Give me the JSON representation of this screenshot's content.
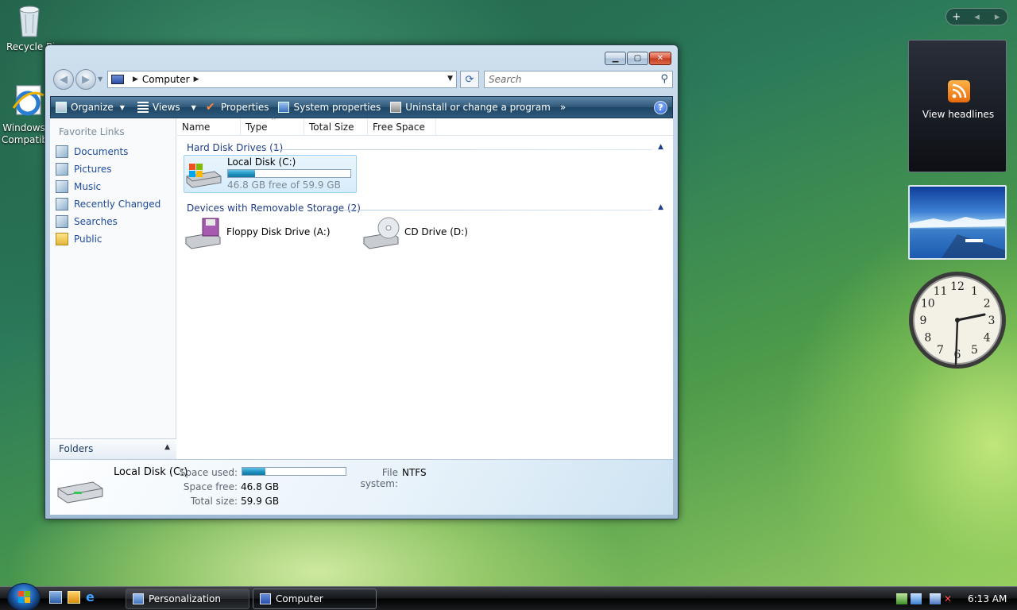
{
  "desktop": {
    "icons": [
      {
        "label": "Recycle Bin",
        "icon": "recycle-bin-icon"
      },
      {
        "label": "Windows Compatib",
        "icon": "internet-explorer-icon"
      }
    ]
  },
  "window": {
    "title": "Computer",
    "caption_buttons": [
      "minimize",
      "maximize",
      "close"
    ],
    "address": {
      "path": [
        "Computer"
      ],
      "icon": "computer-icon"
    },
    "search": {
      "placeholder": "Search"
    },
    "commands": [
      {
        "label": "Organize",
        "icon": "organize-icon",
        "has_dropdown": true
      },
      {
        "label": "Views",
        "icon": "views-icon",
        "has_dropdown": true
      },
      {
        "label": "Properties",
        "icon": "properties-icon"
      },
      {
        "label": "System properties",
        "icon": "system-properties-icon"
      },
      {
        "label": "Uninstall or change a program",
        "icon": "uninstall-icon"
      }
    ],
    "more_label": "»",
    "help_label": "?",
    "favorite_links": {
      "title": "Favorite Links",
      "items": [
        {
          "label": "Documents",
          "icon": "documents-icon"
        },
        {
          "label": "Pictures",
          "icon": "pictures-icon"
        },
        {
          "label": "Music",
          "icon": "music-icon"
        },
        {
          "label": "Recently Changed",
          "icon": "recently-changed-icon"
        },
        {
          "label": "Searches",
          "icon": "searches-icon"
        },
        {
          "label": "Public",
          "icon": "public-folder-icon"
        }
      ]
    },
    "folders_label": "Folders",
    "columns": [
      "Name",
      "Type",
      "Total Size",
      "Free Space"
    ],
    "groups": [
      {
        "title": "Hard Disk Drives (1)",
        "items": [
          {
            "name": "Local Disk (C:)",
            "free_text": "46.8 GB free of 59.9 GB",
            "used_fraction": 0.22,
            "icon": "hard-disk-icon",
            "selected": true
          }
        ]
      },
      {
        "title": "Devices with Removable Storage (2)",
        "items": [
          {
            "name": "Floppy Disk Drive (A:)",
            "icon": "floppy-drive-icon"
          },
          {
            "name": "CD Drive (D:)",
            "icon": "cd-drive-icon"
          }
        ]
      }
    ],
    "details": {
      "title": "Local Disk (C:)",
      "space_used_label": "Space used:",
      "space_used_fraction": 0.22,
      "file_system_label": "File system:",
      "file_system": "NTFS",
      "space_free_label": "Space free:",
      "space_free": "46.8 GB",
      "total_size_label": "Total size:",
      "total_size": "59.9 GB"
    }
  },
  "sidebar": {
    "controls": [
      "+",
      "◂",
      "▸"
    ],
    "feed_label": "View headlines",
    "clock_numbers": [
      "12",
      "1",
      "2",
      "3",
      "4",
      "5",
      "6",
      "7",
      "8",
      "9",
      "10",
      "11"
    ]
  },
  "taskbar": {
    "tasks": [
      {
        "label": "Personalization",
        "icon": "personalization-icon",
        "active": false
      },
      {
        "label": "Computer",
        "icon": "computer-icon",
        "active": true
      }
    ],
    "time": "6:13 AM"
  }
}
